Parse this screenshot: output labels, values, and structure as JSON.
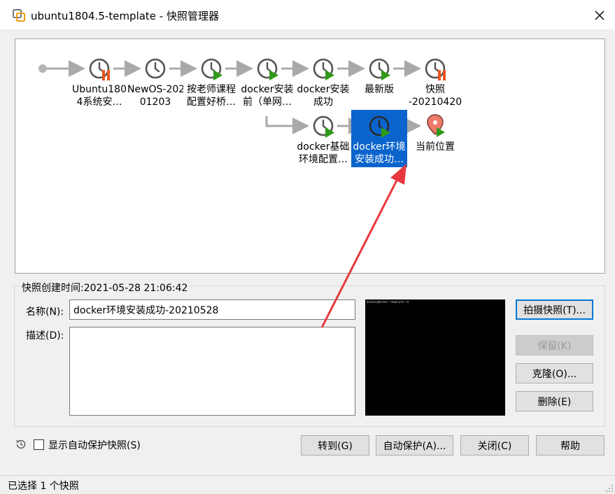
{
  "window": {
    "title": "ubuntu1804.5-template - 快照管理器",
    "icon": "vmware-workstation-icon",
    "close_icon": "close-icon"
  },
  "tree": {
    "nodes": [
      {
        "id": "n1",
        "icon": "snapshot-clock-paused-icon",
        "lines": [
          "Ubuntu180",
          "4系统安…"
        ]
      },
      {
        "id": "n2",
        "icon": "snapshot-clock-icon",
        "lines": [
          "NewOS-202",
          "01203"
        ]
      },
      {
        "id": "n3",
        "icon": "snapshot-clock-running-icon",
        "lines": [
          "按老师课程",
          "配置好桥…"
        ]
      },
      {
        "id": "n4",
        "icon": "snapshot-clock-running-icon",
        "lines": [
          "docker安装",
          "前（单网…"
        ]
      },
      {
        "id": "n5",
        "icon": "snapshot-clock-running-icon",
        "lines": [
          "docker安装",
          "成功"
        ]
      },
      {
        "id": "n6",
        "icon": "snapshot-clock-running-icon",
        "lines": [
          "最新版",
          ""
        ]
      },
      {
        "id": "n7",
        "icon": "snapshot-clock-paused-icon",
        "lines": [
          "快照",
          "-20210420"
        ]
      },
      {
        "id": "n8",
        "icon": "snapshot-clock-running-icon",
        "lines": [
          "docker基础",
          "环境配置…"
        ]
      },
      {
        "id": "n9",
        "icon": "snapshot-clock-running-icon",
        "lines": [
          "docker环境",
          "安装成功…"
        ],
        "selected": true
      },
      {
        "id": "n10",
        "icon": "current-location-pin-icon",
        "lines": [
          "当前位置",
          ""
        ]
      }
    ]
  },
  "details": {
    "created_label": "快照创建时间:2021-05-28 21:06:42",
    "name_label": "名称(N):",
    "name_value": "docker环境安装成功-20210528",
    "desc_label": "描述(D):",
    "desc_value": "",
    "thumbnail_text": "docker@docker-template:~$"
  },
  "side_buttons": {
    "take": "拍摄快照(T)...",
    "keep": "保留(K)",
    "clone": "克隆(O)...",
    "delete": "删除(E)"
  },
  "bottom": {
    "show_autoprotect": "显示自动保护快照(S)",
    "show_autoprotect_checked": false,
    "goto": "转到(G)",
    "autoprotect": "自动保护(A)...",
    "close": "关闭(C)",
    "help": "帮助"
  },
  "status": {
    "text": "已选择 1 个快照"
  },
  "colors": {
    "selection": "#0a64cc",
    "connector": "#a9a9a9",
    "play": "#2e9b1a",
    "pause": "#e8561e",
    "pin": "#f07a6a",
    "annotation_arrow": "#e8383d"
  }
}
